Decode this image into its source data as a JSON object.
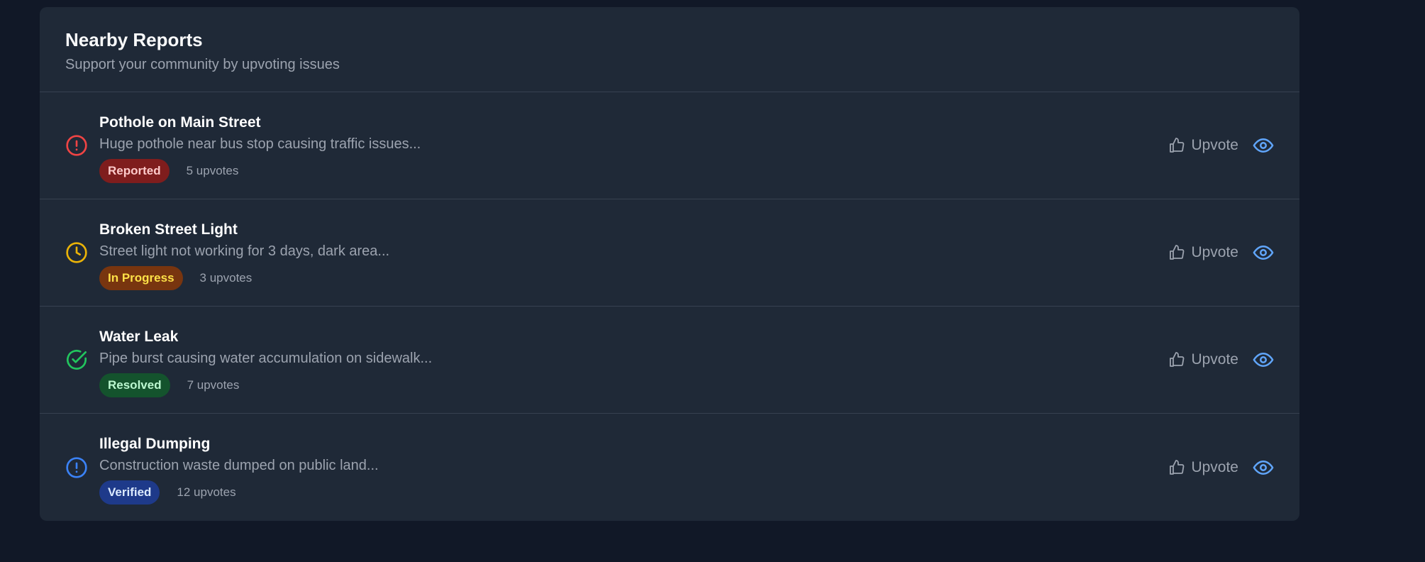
{
  "panel": {
    "title": "Nearby Reports",
    "subtitle": "Support your community by upvoting issues"
  },
  "reports": [
    {
      "title": "Pothole on Main Street",
      "description": "Huge pothole near bus stop causing traffic issues...",
      "status": "Reported",
      "upvotes": "5 upvotes",
      "upvote_label": "Upvote",
      "icon": "alert-circle-icon",
      "icon_color": "#ef4444",
      "badge_bg": "#7f1d1d",
      "badge_fg": "#fecaca"
    },
    {
      "title": "Broken Street Light",
      "description": "Street light not working for 3 days, dark area...",
      "status": "In Progress",
      "upvotes": "3 upvotes",
      "upvote_label": "Upvote",
      "icon": "clock-icon",
      "icon_color": "#eab308",
      "badge_bg": "#78350f",
      "badge_fg": "#fde047"
    },
    {
      "title": "Water Leak",
      "description": "Pipe burst causing water accumulation on sidewalk...",
      "status": "Resolved",
      "upvotes": "7 upvotes",
      "upvote_label": "Upvote",
      "icon": "check-circle-icon",
      "icon_color": "#22c55e",
      "badge_bg": "#14532d",
      "badge_fg": "#bbf7d0"
    },
    {
      "title": "Illegal Dumping",
      "description": "Construction waste dumped on public land...",
      "status": "Verified",
      "upvotes": "12 upvotes",
      "upvote_label": "Upvote",
      "icon": "info-circle-icon",
      "icon_color": "#3b82f6",
      "badge_bg": "#1e3a8a",
      "badge_fg": "#dbeafe"
    }
  ],
  "colors": {
    "view_icon": "#60a5fa",
    "upvote_icon": "#9ca3af"
  }
}
